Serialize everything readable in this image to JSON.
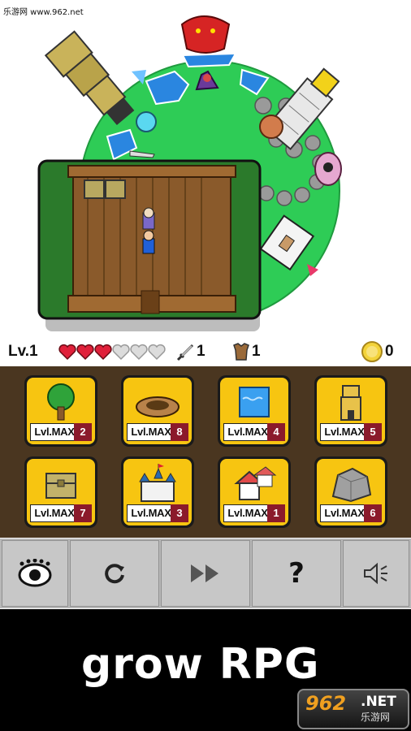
{
  "watermark": "乐游网 www.962.net",
  "status": {
    "level": "Lv.1",
    "hearts_total": 6,
    "hearts_filled": 3,
    "attack": "1",
    "defense": "1",
    "coins": "0"
  },
  "items": [
    {
      "label": "Lvl.MAX",
      "count": "2",
      "icon": "tree-icon"
    },
    {
      "label": "Lvl.MAX",
      "count": "8",
      "icon": "hole-icon"
    },
    {
      "label": "Lvl.MAX",
      "count": "4",
      "icon": "water-icon"
    },
    {
      "label": "Lvl.MAX",
      "count": "5",
      "icon": "tower-icon"
    },
    {
      "label": "Lvl.MAX",
      "count": "7",
      "icon": "chest-icon"
    },
    {
      "label": "Lvl.MAX",
      "count": "3",
      "icon": "castle-icon"
    },
    {
      "label": "Lvl.MAX",
      "count": "1",
      "icon": "house-icon"
    },
    {
      "label": "Lvl.MAX",
      "count": "6",
      "icon": "rock-icon"
    }
  ],
  "toolbar": [
    "eye-icon",
    "rotate-icon",
    "fast-forward-icon",
    "help-icon",
    "sound-icon"
  ],
  "help_label": "?",
  "title": "grow RPG",
  "logo": {
    "num": "962",
    "net": ".NET",
    "cn": "乐游网"
  },
  "colors": {
    "card_bg": "#f7c511",
    "grid_bg": "#4a3620",
    "count_bg": "#8b1a2b",
    "planet": "#2ecc56"
  }
}
